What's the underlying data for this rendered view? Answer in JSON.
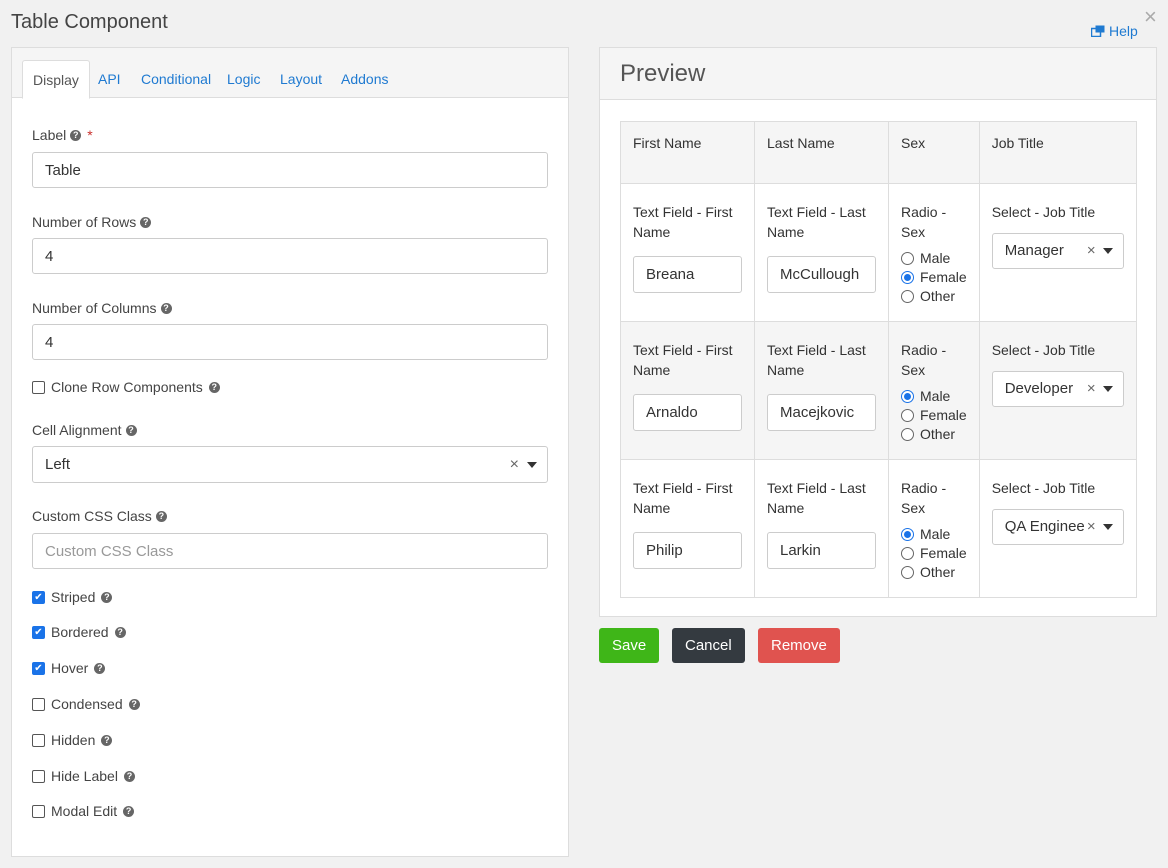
{
  "dialog": {
    "title": "Table Component",
    "help_label": "Help",
    "close_glyph": "×"
  },
  "tabs": [
    "Display",
    "API",
    "Conditional",
    "Logic",
    "Layout",
    "Addons"
  ],
  "form": {
    "label_field": {
      "label": "Label",
      "value": "Table"
    },
    "rows_field": {
      "label": "Number of Rows",
      "value": "4"
    },
    "cols_field": {
      "label": "Number of Columns",
      "value": "4"
    },
    "clone_row": {
      "label": "Clone Row Components",
      "checked": false
    },
    "cell_alignment": {
      "label": "Cell Alignment",
      "value": "Left"
    },
    "custom_css": {
      "label": "Custom CSS Class",
      "placeholder": "Custom CSS Class",
      "value": ""
    },
    "checkboxes": [
      {
        "label": "Striped",
        "checked": true
      },
      {
        "label": "Bordered",
        "checked": true
      },
      {
        "label": "Hover",
        "checked": true
      },
      {
        "label": "Condensed",
        "checked": false
      },
      {
        "label": "Hidden",
        "checked": false
      },
      {
        "label": "Hide Label",
        "checked": false
      },
      {
        "label": "Modal Edit",
        "checked": false
      }
    ]
  },
  "preview": {
    "title": "Preview",
    "headers": [
      "First Name",
      "Last Name",
      "Sex",
      "Job Title"
    ],
    "cell_labels": {
      "first": "Text Field - First Name",
      "last": "Text Field - Last Name",
      "sex": "Radio - Sex",
      "job": "Select - Job Title"
    },
    "sex_options": [
      "Male",
      "Female",
      "Other"
    ],
    "rows": [
      {
        "first": "Breana",
        "last": "McCullough",
        "sex": "Female",
        "job": "Manager"
      },
      {
        "first": "Arnaldo",
        "last": "Macejkovic",
        "sex": "Male",
        "job": "Developer"
      },
      {
        "first": "Philip",
        "last": "Larkin",
        "sex": "Male",
        "job": "QA Engineer"
      }
    ]
  },
  "buttons": {
    "save": {
      "label": "Save",
      "color": "#3fb618"
    },
    "cancel": {
      "label": "Cancel",
      "color": "#343a40"
    },
    "remove": {
      "label": "Remove",
      "color": "#e0534f"
    }
  },
  "colors": {
    "accent": "#1f7ad1",
    "checkbox": "#1a73e8"
  }
}
